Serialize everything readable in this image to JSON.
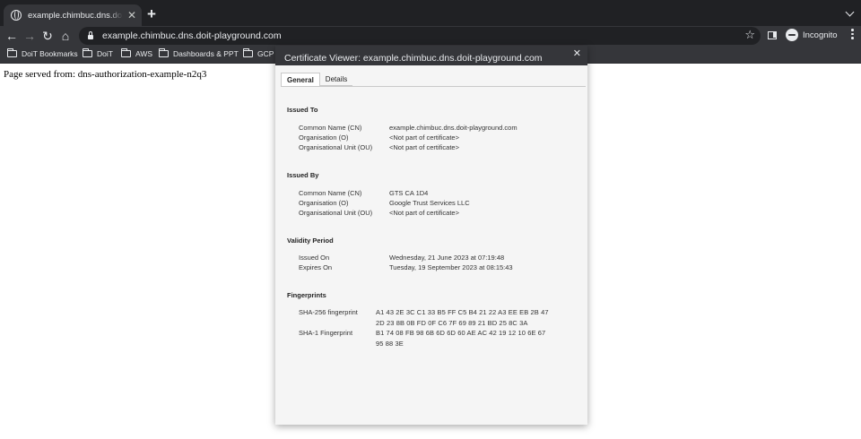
{
  "browser": {
    "tab": {
      "title": "example.chimbuc.dns.doit-playground.com",
      "close": "✕"
    },
    "new_tab": "+",
    "nav": {
      "back": "←",
      "forward": "→",
      "reload": "↻",
      "home": "⌂"
    },
    "url": "example.chimbuc.dns.doit-playground.com",
    "star": "☆",
    "incognito_label": "Incognito",
    "bookmarks": [
      {
        "label": "DoiT Bookmarks"
      },
      {
        "label": "DoiT"
      },
      {
        "label": "AWS"
      },
      {
        "label": "Dashboards & PPT"
      },
      {
        "label": "GCP"
      }
    ]
  },
  "page": {
    "text": "Page served from: dns-authorization-example-n2q3"
  },
  "dialog": {
    "title": "Certificate Viewer: example.chimbuc.dns.doit-playground.com",
    "close": "✕",
    "tabs": [
      "General",
      "Details"
    ],
    "issued_to": {
      "heading": "Issued To",
      "rows": [
        {
          "label": "Common Name (CN)",
          "value": "example.chimbuc.dns.doit-playground.com"
        },
        {
          "label": "Organisation (O)",
          "value": "<Not part of certificate>"
        },
        {
          "label": "Organisational Unit (OU)",
          "value": "<Not part of certificate>"
        }
      ]
    },
    "issued_by": {
      "heading": "Issued By",
      "rows": [
        {
          "label": "Common Name (CN)",
          "value": "GTS CA 1D4"
        },
        {
          "label": "Organisation (O)",
          "value": "Google Trust Services LLC"
        },
        {
          "label": "Organisational Unit (OU)",
          "value": "<Not part of certificate>"
        }
      ]
    },
    "validity": {
      "heading": "Validity Period",
      "rows": [
        {
          "label": "Issued On",
          "value": "Wednesday, 21 June 2023 at 07:19:48"
        },
        {
          "label": "Expires On",
          "value": "Tuesday, 19 September 2023 at 08:15:43"
        }
      ]
    },
    "fingerprints": {
      "heading": "Fingerprints",
      "rows": [
        {
          "label": "SHA-256 fingerprint",
          "value": "A1 43 2E 3C C1 33 B5 FF C5 B4 21 22 A3 EE EB 2B 47 2D 23 8B 0B FD 0F C6 7F 69 89 21 BD 25 8C 3A"
        },
        {
          "label": "SHA-1 Fingerprint",
          "value": "B1 74 08 FB 98 6B 6D 6D 60 AE AC 42 19 12 10 6E 67 95 88 3E"
        }
      ]
    }
  }
}
